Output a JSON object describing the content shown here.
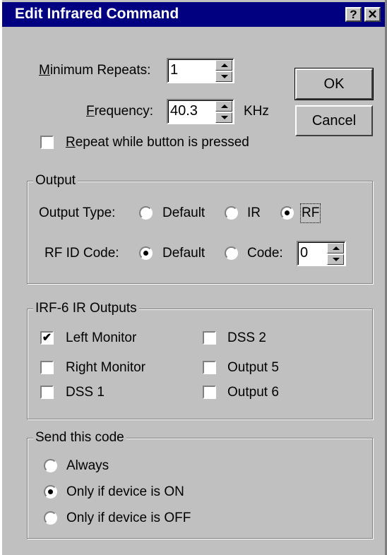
{
  "window": {
    "title": "Edit Infrared Command",
    "help_label": "?",
    "close_label": "✕"
  },
  "min_repeats": {
    "label_mnemonic": "M",
    "label_rest": "inimum Repeats:",
    "value": "1"
  },
  "frequency": {
    "label_mnemonic": "F",
    "label_rest": "requency:",
    "value": "40.3",
    "unit": "KHz"
  },
  "repeat_while_pressed": {
    "label_mnemonic": "R",
    "label_rest": "epeat while button is pressed",
    "checked": false
  },
  "buttons": {
    "ok": "OK",
    "cancel": "Cancel"
  },
  "output": {
    "group_title": "Output",
    "type_label": "Output Type:",
    "type_options": [
      "Default",
      "IR",
      "RF"
    ],
    "type_selected": "RF",
    "rf_label": "RF ID Code:",
    "rf_options": [
      "Default",
      "Code:"
    ],
    "rf_selected": "Default",
    "rf_code_value": "0"
  },
  "irf_outputs": {
    "group_title": "IRF-6 IR Outputs",
    "items": [
      {
        "label": "Left Monitor",
        "checked": true
      },
      {
        "label": "Right Monitor",
        "checked": false
      },
      {
        "label": "DSS 1",
        "checked": false
      },
      {
        "label": "DSS 2",
        "checked": false
      },
      {
        "label": "Output 5",
        "checked": false
      },
      {
        "label": "Output 6",
        "checked": false
      }
    ]
  },
  "send_code": {
    "group_title": "Send this code",
    "options": [
      "Always",
      "Only if device is ON",
      "Only if device is OFF"
    ],
    "selected": "Only if device is ON"
  },
  "colors": {
    "titlebar": "#000080",
    "face": "#c0c0c0"
  }
}
